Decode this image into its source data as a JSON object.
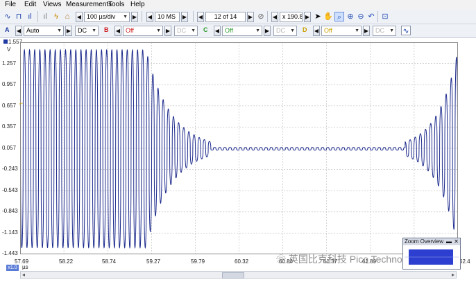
{
  "menu": [
    "File",
    "Edit",
    "Views",
    "Measurements",
    "Tools",
    "Help"
  ],
  "toolbar1": {
    "timebase": "100 µs/div",
    "samples": "10 MS",
    "buffer": "12 of 14",
    "zoom": "x 190.8"
  },
  "toolbar2": {
    "channels": [
      {
        "letter": "A",
        "range": "Auto",
        "coupling": "DC",
        "color": "#1f3aa0"
      },
      {
        "letter": "B",
        "range": "Off",
        "coupling": "DC",
        "color": "#d02020"
      },
      {
        "letter": "C",
        "range": "Off",
        "coupling": "DC",
        "color": "#2a9a2a"
      },
      {
        "letter": "D",
        "range": "Off",
        "coupling": "DC",
        "color": "#c8a000"
      }
    ]
  },
  "axis": {
    "y_top": "1.557",
    "y_unit": "V",
    "y_ticks": [
      "1.257",
      "0.957",
      "0.657",
      "0.357",
      "0.057",
      "-0.243",
      "-0.543",
      "-0.843",
      "-1.143",
      "-1.443"
    ],
    "x_ticks": [
      "57.69",
      "58.22",
      "58.74",
      "59.27",
      "59.79",
      "60.32",
      "60.84",
      "61.37",
      "61.89",
      "62.4"
    ],
    "x_unit": "µs",
    "x_badge": "x1.0"
  },
  "zoom_overview": {
    "title": "Zoom Overview"
  },
  "watermark": "英国比克科技 Pico Technology",
  "chart_data": {
    "type": "line",
    "title": "",
    "xlabel": "µs",
    "ylabel": "V",
    "xlim": [
      57.69,
      62.42
    ],
    "ylim": [
      -1.443,
      1.557
    ],
    "series": [
      {
        "color": "#1c2a8c",
        "segments": [
          {
            "from": 57.69,
            "to": 59.05,
            "amplitude": 1.4,
            "center": 0.05,
            "note": "full-amplitude oscillation"
          },
          {
            "from": 59.05,
            "to": 59.75,
            "amplitude_start": 1.4,
            "amplitude_end": 0.1,
            "center": 0.05,
            "note": "decaying ring-down"
          },
          {
            "from": 59.75,
            "to": 61.85,
            "amplitude": 0.02,
            "center": 0.05,
            "note": "flat near zero"
          },
          {
            "from": 61.85,
            "to": 62.42,
            "amplitude_start": 0.1,
            "amplitude_end": 1.4,
            "center": 0.05,
            "note": "rising oscillation"
          }
        ],
        "cycles_per_us": 18
      }
    ]
  }
}
